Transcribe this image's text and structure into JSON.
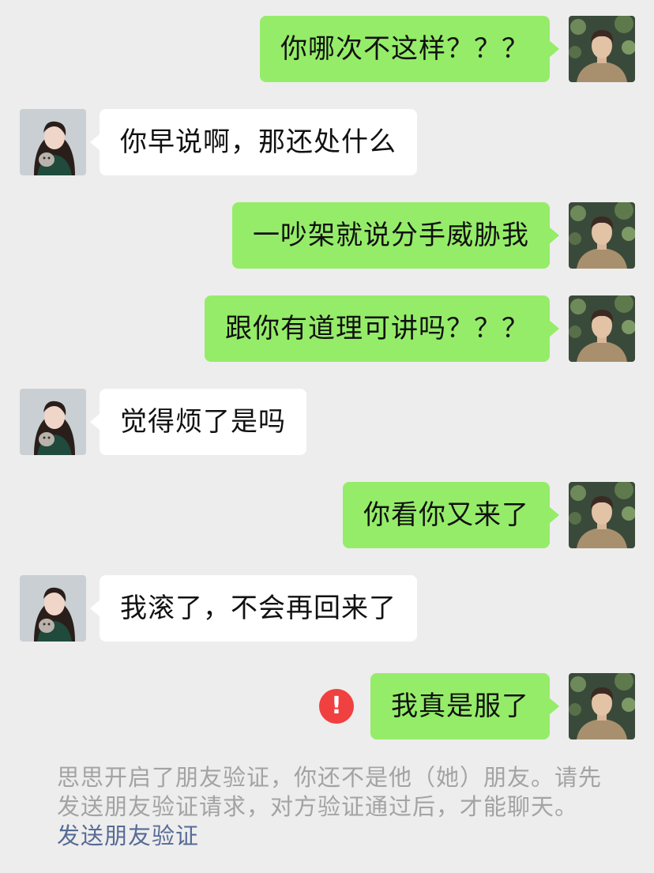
{
  "colors": {
    "background": "#ededed",
    "outgoing_bubble": "#95ec69",
    "incoming_bubble": "#ffffff",
    "error": "#f04040",
    "notice_text": "#a3a3a3",
    "link": "#576b95"
  },
  "messages": [
    {
      "side": "right",
      "text": "你哪次不这样？？？"
    },
    {
      "side": "left",
      "text": "你早说啊，那还处什么"
    },
    {
      "side": "right",
      "text": "一吵架就说分手威胁我"
    },
    {
      "side": "right",
      "text": "跟你有道理可讲吗？？？"
    },
    {
      "side": "left",
      "text": "觉得烦了是吗"
    },
    {
      "side": "right",
      "text": "你看你又来了"
    },
    {
      "side": "left",
      "text": "我滚了，不会再回来了"
    },
    {
      "side": "right",
      "text": "我真是服了",
      "send_failed": true
    }
  ],
  "failed_icon": {
    "icon": "exclamation-icon",
    "glyph": "!"
  },
  "system_notice": {
    "text": "思思开启了朋友验证，你还不是他（她）朋友。请先发送朋友验证请求，对方验证通过后，才能聊天。",
    "link_label": "发送朋友验证"
  }
}
